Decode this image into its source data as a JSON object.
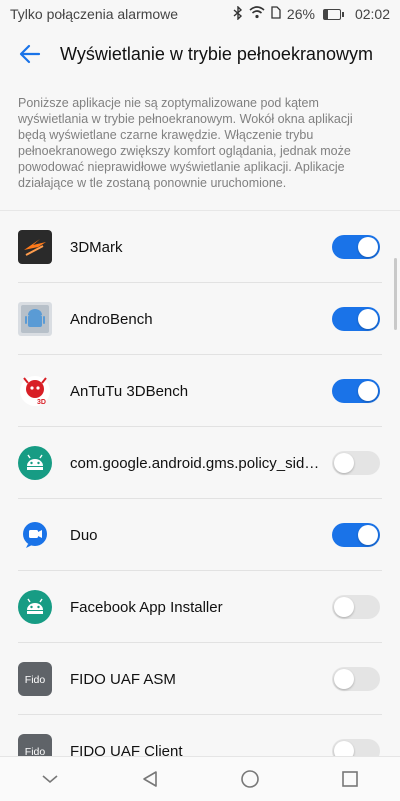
{
  "status_bar": {
    "carrier_text": "Tylko połączenia alarmowe",
    "battery_text": "26%",
    "battery_level": 0.26,
    "time": "02:02",
    "icons": [
      "bluetooth-icon",
      "wifi-icon",
      "sim-icon",
      "battery-icon"
    ]
  },
  "header": {
    "title": "Wyświetlanie w trybie pełnoekranowym",
    "back_icon": "back-arrow-icon"
  },
  "intro_text": "Poniższe aplikacje nie są zoptymalizowane pod kątem wyświetlania w trybie pełnoekranowym. Wokół okna aplikacji będą wyświetlane czarne krawędzie. Włączenie trybu pełnoekranowego zwiększy komfort oglądania, jednak może powodować nieprawidłowe wyświetlanie aplikacji. Aplikacje działające w tle zostaną ponownie uruchomione.",
  "apps": [
    {
      "name": "3DMark",
      "enabled": true,
      "icon": "3dmark-icon"
    },
    {
      "name": "AndroBench",
      "enabled": true,
      "icon": "androbench-icon"
    },
    {
      "name": "AnTuTu 3DBench",
      "enabled": true,
      "icon": "antutu-3dbench-icon"
    },
    {
      "name": "com.google.android.gms.policy_sidec...",
      "enabled": false,
      "icon": "android-icon"
    },
    {
      "name": "Duo",
      "enabled": true,
      "icon": "duo-icon"
    },
    {
      "name": "Facebook App Installer",
      "enabled": false,
      "icon": "android-icon"
    },
    {
      "name": "FIDO UAF ASM",
      "enabled": false,
      "icon": "fido-icon",
      "icon_label": "Fido"
    },
    {
      "name": "FIDO UAF Client",
      "enabled": false,
      "icon": "fido-icon",
      "icon_label": "Fido"
    }
  ],
  "colors": {
    "accent": "#1a73e8",
    "toggle_off": "#e4e4e4",
    "background": "#f7f7f7"
  },
  "nav_bar": {
    "icons": [
      "nav-hide-icon",
      "nav-back-icon",
      "nav-home-icon",
      "nav-recents-icon"
    ]
  }
}
